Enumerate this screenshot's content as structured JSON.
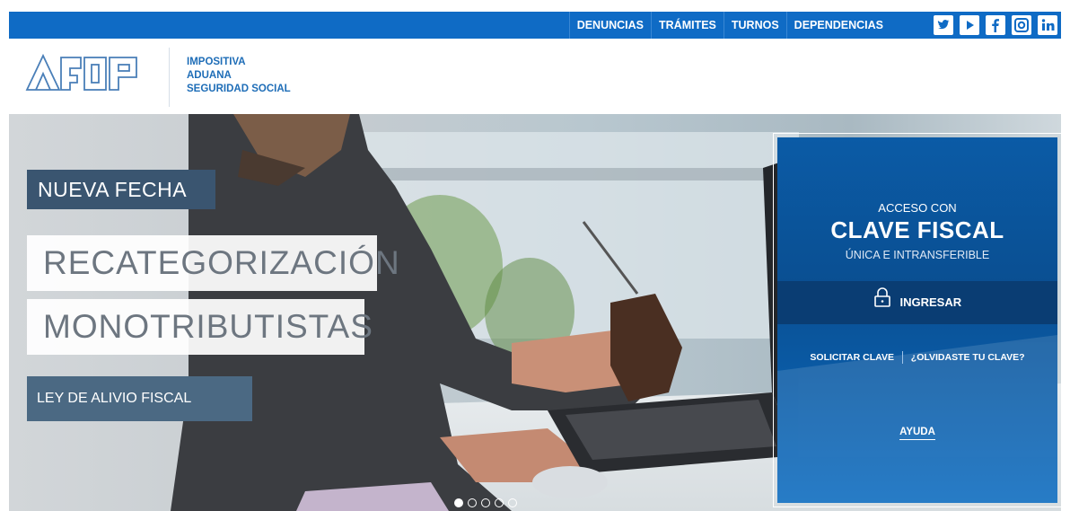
{
  "topnav": {
    "items": [
      {
        "label": "DENUNCIAS"
      },
      {
        "label": "TRÁMITES"
      },
      {
        "label": "TURNOS"
      },
      {
        "label": "DEPENDENCIAS"
      }
    ],
    "socials": [
      {
        "icon": "twitter-icon"
      },
      {
        "icon": "youtube-icon"
      },
      {
        "icon": "facebook-icon"
      },
      {
        "icon": "instagram-icon"
      },
      {
        "icon": "linkedin-icon"
      }
    ],
    "color": "#0f6bc5"
  },
  "header": {
    "logo_text": "AFIP",
    "tagline": [
      "IMPOSITIVA",
      "ADUANA",
      "SEGURIDAD SOCIAL"
    ]
  },
  "hero": {
    "badge": "NUEVA FECHA",
    "title_line1": "RECATEGORIZACIÓN",
    "title_line2": "MONOTRIBUTISTAS",
    "subtitle": "LEY DE ALIVIO FISCAL",
    "slides_count": 5,
    "active_slide": 1
  },
  "login": {
    "access_label": "ACCESO CON",
    "title": "CLAVE FISCAL",
    "subtitle": "ÚNICA E INTRANSFERIBLE",
    "login_button": "INGRESAR",
    "request_link": "SOLICITAR CLAVE",
    "forgot_link": "¿OLVIDASTE TU CLAVE?",
    "help_link": "AYUDA",
    "color": "#0b5ba6"
  }
}
